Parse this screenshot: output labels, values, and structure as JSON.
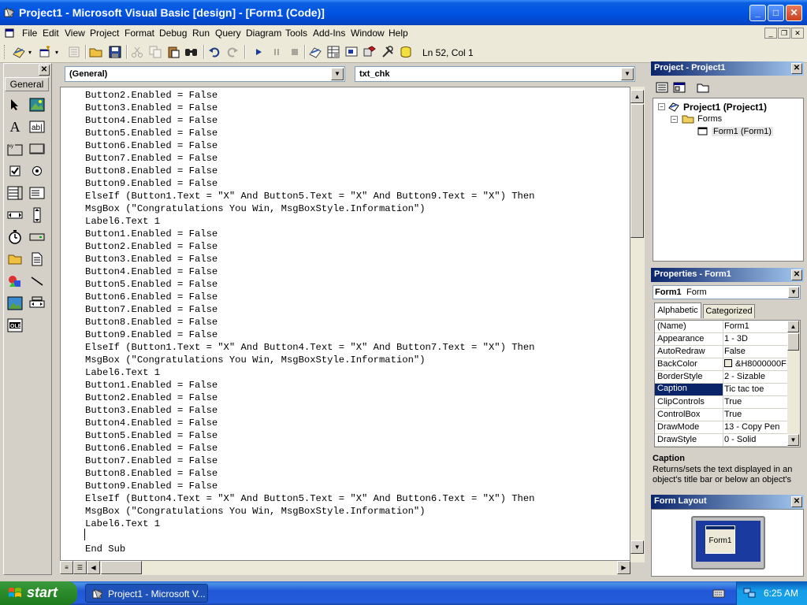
{
  "window": {
    "title": "Project1 - Microsoft Visual Basic [design] - [Form1 (Code)]",
    "controls": {
      "minimize": "_",
      "maximize": "□",
      "close": "✕"
    }
  },
  "menu": [
    "File",
    "Edit",
    "View",
    "Project",
    "Format",
    "Debug",
    "Run",
    "Query",
    "Diagram",
    "Tools",
    "Add-Ins",
    "Window",
    "Help"
  ],
  "toolbar": {
    "icons": [
      "add-project-icon",
      "add-form-icon",
      "menu-editor-icon",
      "open-icon",
      "save-icon",
      "cut-icon",
      "copy-icon",
      "paste-icon",
      "find-icon",
      "undo-icon",
      "redo-icon",
      "start-icon",
      "break-icon",
      "end-icon",
      "project-explorer-icon",
      "properties-window-icon",
      "form-layout-icon",
      "object-browser-icon",
      "toolbox-icon",
      "data-view-icon"
    ],
    "cursor_position": "Ln 52, Col 1"
  },
  "toolbox": {
    "tab_label": "General",
    "tools": [
      "pointer",
      "picturebox",
      "label",
      "textbox",
      "frame",
      "commandbutton",
      "checkbox",
      "optionbutton",
      "combobox",
      "listbox",
      "hscrollbar",
      "vscrollbar",
      "timer",
      "drivelistbox",
      "dirlistbox",
      "filelistbox",
      "shape",
      "line",
      "image",
      "data",
      "ole"
    ]
  },
  "code_window": {
    "object_combo": "(General)",
    "procedure_combo": "txt_chk",
    "lines": [
      "Button2.Enabled = False",
      "Button3.Enabled = False",
      "Button4.Enabled = False",
      "Button5.Enabled = False",
      "Button6.Enabled = False",
      "Button7.Enabled = False",
      "Button8.Enabled = False",
      "Button9.Enabled = False",
      "ElseIf (Button1.Text = \"X\" And Button5.Text = \"X\" And Button9.Text = \"X\") Then",
      "MsgBox (\"Congratulations You Win, MsgBoxStyle.Information\")",
      "Label6.Text 1",
      "Button1.Enabled = False",
      "Button2.Enabled = False",
      "Button3.Enabled = False",
      "Button4.Enabled = False",
      "Button5.Enabled = False",
      "Button6.Enabled = False",
      "Button7.Enabled = False",
      "Button8.Enabled = False",
      "Button9.Enabled = False",
      "ElseIf (Button1.Text = \"X\" And Button4.Text = \"X\" And Button7.Text = \"X\") Then",
      "MsgBox (\"Congratulations You Win, MsgBoxStyle.Information\")",
      "Label6.Text 1",
      "Button1.Enabled = False",
      "Button2.Enabled = False",
      "Button3.Enabled = False",
      "Button4.Enabled = False",
      "Button5.Enabled = False",
      "Button6.Enabled = False",
      "Button7.Enabled = False",
      "Button8.Enabled = False",
      "Button9.Enabled = False",
      "ElseIf (Button4.Text = \"X\" And Button5.Text = \"X\" And Button6.Text = \"X\") Then",
      "MsgBox (\"Congratulations You Win, MsgBoxStyle.Information\")",
      "Label6.Text 1",
      "",
      "End Sub"
    ]
  },
  "project_panel": {
    "title": "Project - Project1",
    "tree": {
      "project": "Project1 (Project1)",
      "folder": "Forms",
      "form": "Form1 (Form1)"
    }
  },
  "properties_panel": {
    "title": "Properties - Form1",
    "object_name": "Form1",
    "object_type": "Form",
    "tabs": [
      "Alphabetic",
      "Categorized"
    ],
    "rows": [
      {
        "name": "(Name)",
        "value": "Form1"
      },
      {
        "name": "Appearance",
        "value": "1 - 3D"
      },
      {
        "name": "AutoRedraw",
        "value": "False"
      },
      {
        "name": "BackColor",
        "value": "&H8000000F"
      },
      {
        "name": "BorderStyle",
        "value": "2 - Sizable"
      },
      {
        "name": "Caption",
        "value": "Tic tac toe"
      },
      {
        "name": "ClipControls",
        "value": "True"
      },
      {
        "name": "ControlBox",
        "value": "True"
      },
      {
        "name": "DrawMode",
        "value": "13 - Copy Pen"
      },
      {
        "name": "DrawStyle",
        "value": "0 - Solid"
      }
    ],
    "selected_row": "Caption",
    "description_title": "Caption",
    "description_text": "Returns/sets the text displayed in an object's title bar or below an object's"
  },
  "form_layout_panel": {
    "title": "Form Layout",
    "form_label": "Form1"
  },
  "taskbar": {
    "start_label": "start",
    "task_item": "Project1 - Microsoft V...",
    "clock": "6:25 AM"
  },
  "colors": {
    "xp_blue": "#0054e3",
    "panel_title": "#0a246a",
    "selection": "#0a246a",
    "start_green": "#2a8a2a"
  }
}
